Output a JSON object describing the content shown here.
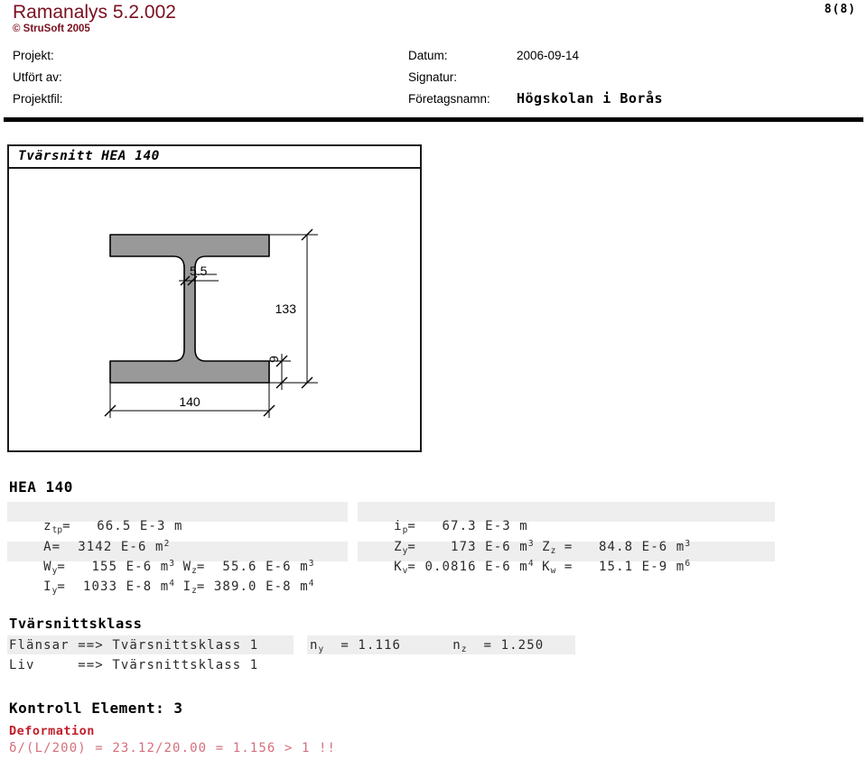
{
  "header": {
    "app_title": "Ramanalys 5.2.002",
    "copyright": "© StruSoft 2005",
    "page_indicator": "8(8)",
    "brand_color": "#7a1020",
    "labels": {
      "projekt": "Projekt:",
      "utfort_av": "Utfört av:",
      "projektfil": "Projektfil:",
      "datum": "Datum:",
      "signatur": "Signatur:",
      "foretagsnamn": "Företagsnamn:"
    },
    "values": {
      "projekt": "",
      "utfort_av": "",
      "projektfil": "",
      "datum": "2006-09-14",
      "signatur": "",
      "foretagsnamn": "Högskolan i Borås"
    }
  },
  "section_drawing": {
    "frame_title": "Tvärsnitt HEA 140",
    "profile": "HEA 140",
    "dimensions": {
      "web_thickness": "5.5",
      "height": "133",
      "flange_thickness": "9",
      "width": "140"
    },
    "fill_color": "#999999",
    "stroke_color": "#000000"
  },
  "properties": {
    "heading": "HEA 140",
    "left_column": [
      {
        "sym": "z",
        "sub": "tp",
        "eq": "=",
        "val": "66.5",
        "exp": "E-3",
        "unit": "m",
        "unit_sup": ""
      },
      {
        "sym": "A",
        "sub": "",
        "eq": "=",
        "val": "3142",
        "exp": "E-6",
        "unit": "m",
        "unit_sup": "2"
      },
      {
        "sym": "W",
        "sub": "y",
        "eq": "=",
        "val": "155",
        "exp": "E-6",
        "unit": "m",
        "unit_sup": "3",
        "sym2": "W",
        "sub2": "z",
        "eq2": "=",
        "val2": "55.6",
        "exp2": "E-6",
        "unit2": "m",
        "unit_sup2": "3"
      },
      {
        "sym": "I",
        "sub": "y",
        "eq": "=",
        "val": "1033",
        "exp": "E-8",
        "unit": "m",
        "unit_sup": "4",
        "sym2": "I",
        "sub2": "z",
        "eq2": "=",
        "val2": "389.0",
        "exp2": "E-8",
        "unit2": "m",
        "unit_sup2": "4"
      }
    ],
    "right_column": [
      {
        "sym": "i",
        "sub": "p",
        "eq": "=",
        "val": "67.3",
        "exp": "E-3",
        "unit": "m",
        "unit_sup": ""
      },
      {
        "sym": "Z",
        "sub": "y",
        "eq": "=",
        "val": "173",
        "exp": "E-6",
        "unit": "m",
        "unit_sup": "3",
        "sym2": "Z",
        "sub2": "z",
        "eq2": "=",
        "val2": "84.8",
        "exp2": "E-6",
        "unit2": "m",
        "unit_sup2": "3"
      },
      {
        "sym": "K",
        "sub": "v",
        "eq": "=",
        "val": "0.0816",
        "exp": "E-6",
        "unit": "m",
        "unit_sup": "4",
        "sym2": "K",
        "sub2": "w",
        "eq2": "=",
        "val2": "15.1",
        "exp2": "E-9",
        "unit2": "m",
        "unit_sup2": "6"
      }
    ]
  },
  "tvarsnittsklass": {
    "heading": "Tvärsnittsklass",
    "rows": [
      "Flänsar ==> Tvärsnittsklass 1",
      "Liv     ==> Tvärsnittsklass 1"
    ],
    "n_values": {
      "ny_label": "n",
      "ny_sub": "y",
      "ny_eq": "= 1.116",
      "nz_label": "n",
      "nz_sub": "z",
      "nz_eq": "= 1.250"
    }
  },
  "kontroll": {
    "heading": "Kontroll Element: 3",
    "subheading": "Deformation",
    "subheading_color": "#c0202c",
    "formula": "δ/(L/200) = 23.12/20.00 = 1.156 > 1 !!",
    "formula_color": "#d4707c"
  }
}
